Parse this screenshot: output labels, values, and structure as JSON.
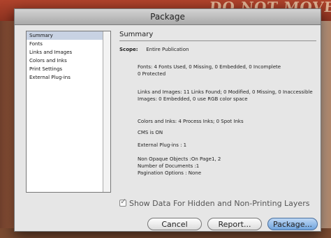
{
  "background": {
    "text": "DO NOT MOVE OR DOCUMENT"
  },
  "dialog": {
    "title": "Package",
    "sidebar": {
      "items": [
        {
          "label": "Summary",
          "selected": true
        },
        {
          "label": "Fonts",
          "selected": false
        },
        {
          "label": "Links and Images",
          "selected": false
        },
        {
          "label": "Colors and Inks",
          "selected": false
        },
        {
          "label": "Print Settings",
          "selected": false
        },
        {
          "label": "External Plug-ins",
          "selected": false
        }
      ]
    },
    "summary": {
      "title": "Summary",
      "scope_label": "Scope:",
      "scope_value": "Entire Publication",
      "fonts": "Fonts: 4 Fonts Used, 0 Missing, 0 Embedded, 0 Incomplete",
      "fonts_line2": "0 Protected",
      "links": "Links and Images: 11 Links Found; 0 Modified, 0 Missing, 0 Inaccessible",
      "images": "Images: 0 Embedded, 0 use RGB color space",
      "colors": "Colors and Inks: 4 Process Inks; 0 Spot Inks",
      "cms": "CMS is ON",
      "plugins": "External Plug-ins : 1",
      "opaque": "Non Opaque Objects :On Page1, 2",
      "documents": "Number of Documents :1",
      "pagination": "Pagination Options : None"
    },
    "checkbox": {
      "label": "Show Data For Hidden and Non-Printing Layers",
      "checked": true
    },
    "buttons": {
      "cancel": "Cancel",
      "report": "Report...",
      "package": "Package..."
    },
    "colors": {
      "selection": "#c8d2e3",
      "primary_button": "#6fa3dc",
      "titlebar": "#a9a9a9"
    }
  }
}
